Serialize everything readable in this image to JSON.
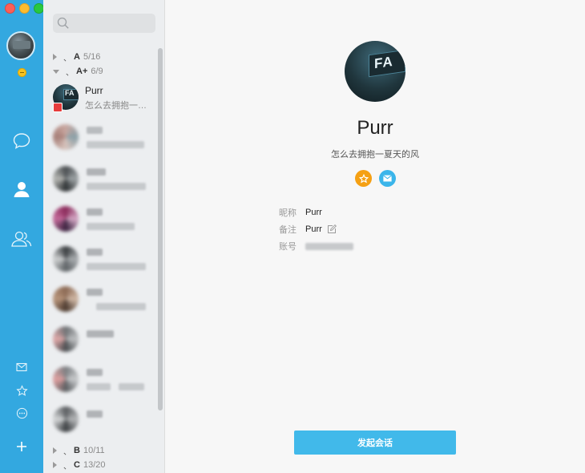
{
  "window": {
    "controls": [
      "close",
      "minimize",
      "maximize"
    ]
  },
  "rail": {
    "items": [
      {
        "icon": "chat-bubble-icon"
      },
      {
        "icon": "contact-person-icon",
        "active": true
      },
      {
        "icon": "group-icon"
      },
      {
        "icon": "mail-icon"
      },
      {
        "icon": "star-icon"
      },
      {
        "icon": "more-icon"
      },
      {
        "icon": "plus-icon"
      }
    ]
  },
  "list": {
    "search": {
      "placeholder": ""
    },
    "groups": [
      {
        "name": "A",
        "count": "5/16",
        "expanded": false
      },
      {
        "name": "A+",
        "count": "6/9",
        "expanded": true
      },
      {
        "name": "B",
        "count": "10/11",
        "expanded": false
      },
      {
        "name": "C",
        "count": "13/20",
        "expanded": false
      }
    ],
    "tick": "、",
    "selected_contact": {
      "name": "Purr",
      "signature": "怎么去拥抱一…"
    }
  },
  "profile": {
    "name": "Purr",
    "signature": "怎么去拥抱一夏天的风",
    "fields": [
      {
        "label": "昵称",
        "value": "Purr"
      },
      {
        "label": "备注",
        "value": "Purr"
      },
      {
        "label": "账号",
        "value": ""
      }
    ],
    "start_chat_label": "发起会话"
  },
  "colors": {
    "rail": "#33a8e0",
    "button": "#41b9ea",
    "vip": "#f5a013",
    "mail": "#3bb5ea"
  }
}
